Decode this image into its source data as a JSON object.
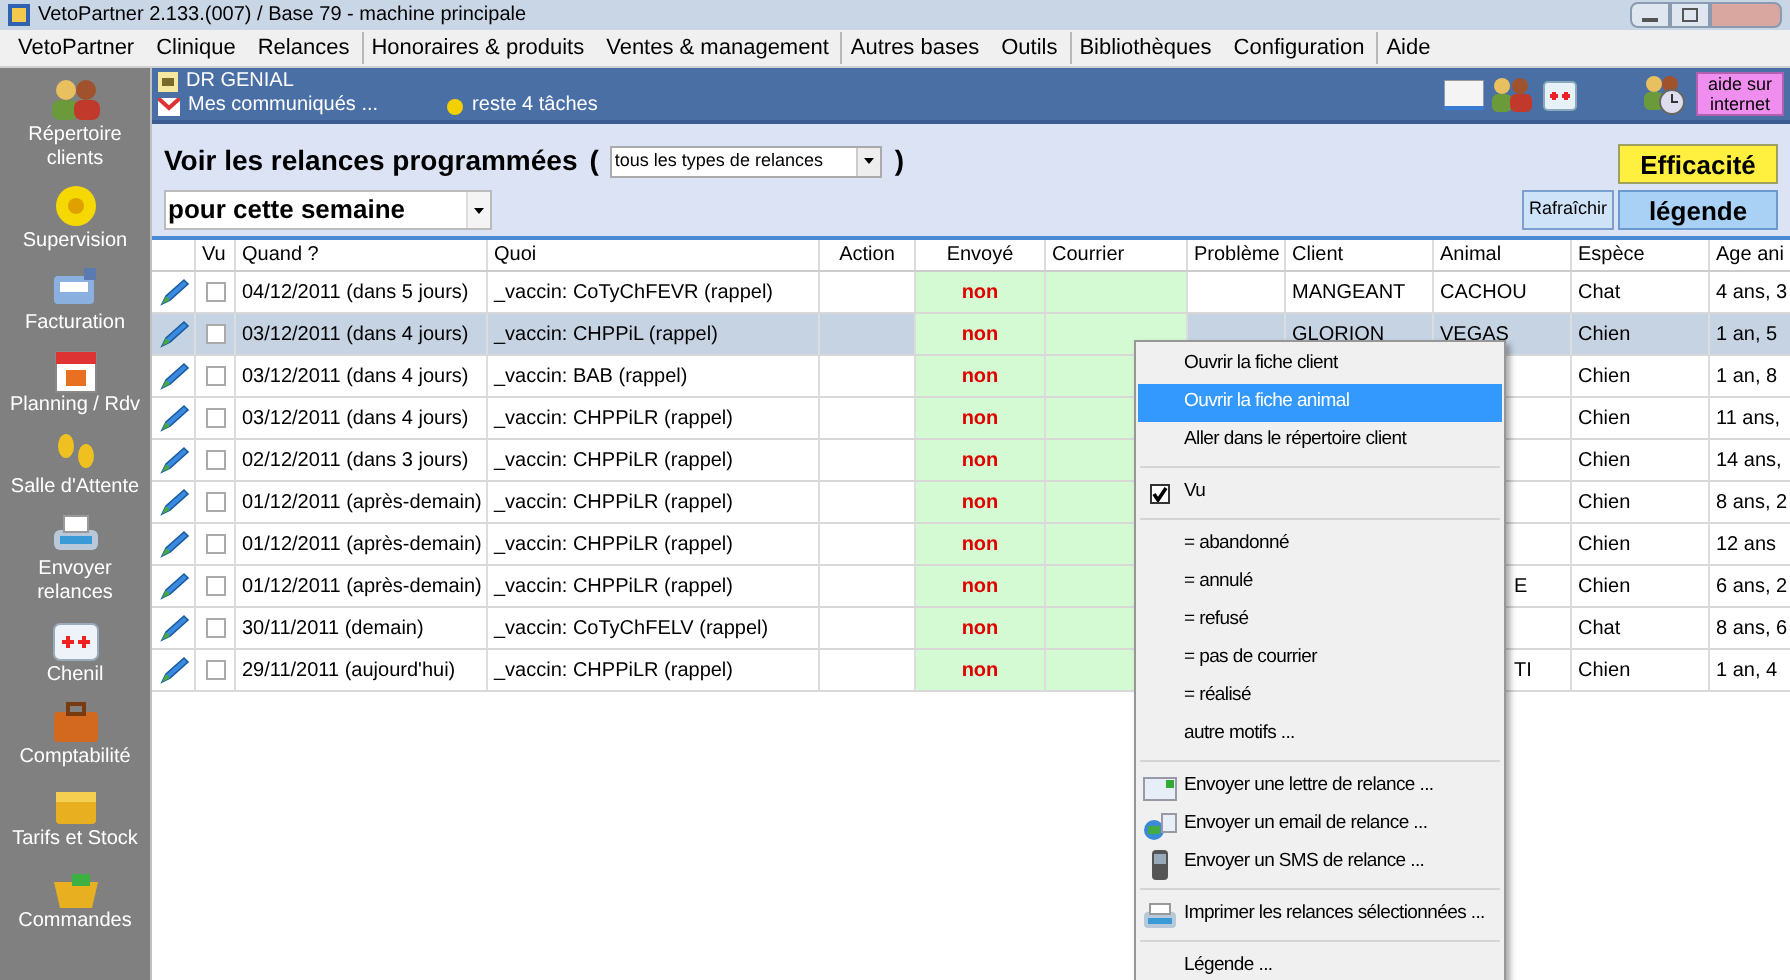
{
  "window": {
    "title": "VetoPartner 2.133.(007) / Base 79 - machine principale"
  },
  "menubar": [
    {
      "label": "VetoPartner",
      "group_start": false
    },
    {
      "label": "Clinique",
      "group_start": false
    },
    {
      "label": "Relances",
      "group_start": false
    },
    {
      "label": "Honoraires & produits",
      "group_start": true
    },
    {
      "label": "Ventes & management",
      "group_start": false
    },
    {
      "label": "Autres bases",
      "group_start": true
    },
    {
      "label": "Outils",
      "group_start": false
    },
    {
      "label": "Bibliothèques",
      "group_start": true
    },
    {
      "label": "Configuration",
      "group_start": false
    },
    {
      "label": "Aide",
      "group_start": true
    }
  ],
  "sidebar": {
    "items": [
      {
        "label": "Répertoire clients"
      },
      {
        "label": "Supervision"
      },
      {
        "label": "Facturation"
      },
      {
        "label": "Planning / Rdv"
      },
      {
        "label": "Salle d'Attente"
      },
      {
        "label": "Envoyer relances"
      },
      {
        "label": "Chenil"
      },
      {
        "label": "Comptabilité"
      },
      {
        "label": "Tarifs et Stock"
      },
      {
        "label": "Commandes"
      }
    ]
  },
  "header": {
    "user": "DR GENIAL",
    "messages": "Mes communiqués ...",
    "tasks": "reste 4 tâches",
    "help_button": "aide sur internet"
  },
  "filters": {
    "title": "Voir les relances programmées",
    "open_paren": "(",
    "close_paren": ")",
    "type_select": "tous les types de relances",
    "period_select": "pour cette semaine"
  },
  "buttons": {
    "efficacite": "Efficacité",
    "refresh": "Rafraîchir",
    "legend": "légende"
  },
  "table": {
    "columns": [
      "Vu",
      "Quand ?",
      "Quoi",
      "Action",
      "Envoyé",
      "Courrier",
      "Problème",
      "Client",
      "Animal",
      "Espèce",
      "Age ani"
    ],
    "rows": [
      {
        "seen": false,
        "selected": false,
        "when": "04/12/2011 (dans 5 jours)",
        "what": "_vaccin: CoTyChFEVR (rappel)",
        "sent": "non",
        "client": "MANGEANT",
        "animal": "CACHOU",
        "species": "Chat",
        "age": "4 ans, 3"
      },
      {
        "seen": false,
        "selected": true,
        "when": "03/12/2011 (dans 4 jours)",
        "what": "_vaccin: CHPPiL (rappel)",
        "sent": "non",
        "client": "GLORION",
        "animal": "VEGAS",
        "species": "Chien",
        "age": "1 an, 5"
      },
      {
        "seen": false,
        "selected": false,
        "when": "03/12/2011 (dans 4 jours)",
        "what": "_vaccin: BAB (rappel)",
        "sent": "non",
        "species": "Chien",
        "age": "1 an, 8"
      },
      {
        "seen": false,
        "selected": false,
        "when": "03/12/2011 (dans 4 jours)",
        "what": "_vaccin: CHPPiLR (rappel)",
        "sent": "non",
        "species": "Chien",
        "age": "11 ans,"
      },
      {
        "seen": false,
        "selected": false,
        "when": "02/12/2011 (dans 3 jours)",
        "what": "_vaccin: CHPPiLR (rappel)",
        "sent": "non",
        "species": "Chien",
        "age": "14 ans,"
      },
      {
        "seen": false,
        "selected": false,
        "when": "01/12/2011 (après-demain)",
        "what": "_vaccin: CHPPiLR (rappel)",
        "sent": "non",
        "species": "Chien",
        "age": "8 ans, 2"
      },
      {
        "seen": false,
        "selected": false,
        "when": "01/12/2011 (après-demain)",
        "what": "_vaccin: CHPPiLR (rappel)",
        "sent": "non",
        "species": "Chien",
        "age": "12 ans"
      },
      {
        "seen": false,
        "selected": false,
        "when": "01/12/2011 (après-demain)",
        "what": "_vaccin: CHPPiLR (rappel)",
        "sent": "non",
        "animal_tail": "E",
        "species": "Chien",
        "age": "6 ans, 2"
      },
      {
        "seen": false,
        "selected": false,
        "when": "30/11/2011 (demain)",
        "what": "_vaccin: CoTyChFELV (rappel)",
        "sent": "non",
        "species": "Chat",
        "age": "8 ans, 6"
      },
      {
        "seen": false,
        "selected": false,
        "when": "29/11/2011 (aujourd'hui)",
        "what": "_vaccin: CHPPiLR (rappel)",
        "sent": "non",
        "animal_tail": "TI",
        "species": "Chien",
        "age": "1 an, 4"
      }
    ]
  },
  "context_menu": {
    "groups": [
      [
        {
          "label": "Ouvrir la fiche client",
          "selected": false
        },
        {
          "label": "Ouvrir la fiche animal",
          "selected": true
        },
        {
          "label": "Aller dans le répertoire client",
          "selected": false
        }
      ],
      [
        {
          "label": "Vu",
          "selected": false,
          "checked": true
        }
      ],
      [
        {
          "label": "= abandonné",
          "selected": false
        },
        {
          "label": "= annulé",
          "selected": false
        },
        {
          "label": "= refusé",
          "selected": false
        },
        {
          "label": "= pas de courrier",
          "selected": false
        },
        {
          "label": "= réalisé",
          "selected": false
        },
        {
          "label": "autre motifs ...",
          "selected": false
        }
      ],
      [
        {
          "label": "Envoyer une lettre de relance ...",
          "selected": false,
          "kind": "letter"
        },
        {
          "label": "Envoyer un email de relance ...",
          "selected": false,
          "kind": "email"
        },
        {
          "label": "Envoyer un SMS de relance ...",
          "selected": false,
          "kind": "phone"
        }
      ],
      [
        {
          "label": "Imprimer les relances sélectionnées ...",
          "selected": false,
          "kind": "print"
        }
      ],
      [
        {
          "label": "Légende ...",
          "selected": false
        }
      ]
    ]
  }
}
